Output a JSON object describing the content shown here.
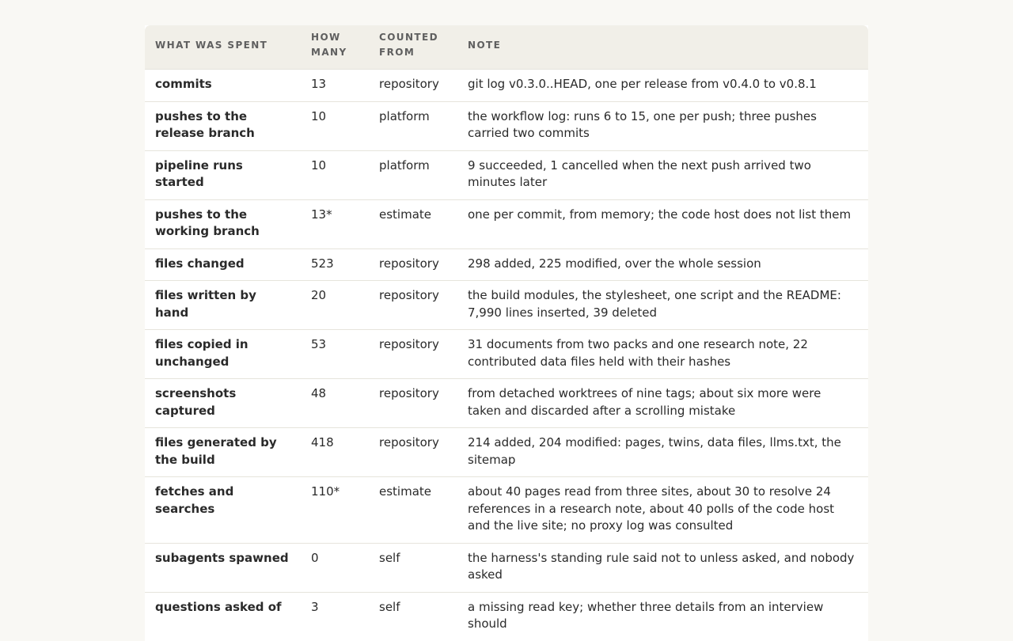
{
  "table": {
    "headers": [
      "WHAT WAS SPENT",
      "HOW MANY",
      "COUNTED FROM",
      "NOTE"
    ],
    "rows": [
      {
        "what": "commits",
        "how_many": "13",
        "counted_from": "repository",
        "note": "git log v0.3.0..HEAD, one per release from v0.4.0 to v0.8.1"
      },
      {
        "what": "pushes to the release branch",
        "how_many": "10",
        "counted_from": "platform",
        "note": "the workflow log: runs 6 to 15, one per push; three pushes carried two commits"
      },
      {
        "what": "pipeline runs started",
        "how_many": "10",
        "counted_from": "platform",
        "note": "9 succeeded, 1 cancelled when the next push arrived two minutes later"
      },
      {
        "what": "pushes to the working branch",
        "how_many": "13*",
        "counted_from": "estimate",
        "note": "one per commit, from memory; the code host does not list them"
      },
      {
        "what": "files changed",
        "how_many": "523",
        "counted_from": "repository",
        "note": "298 added, 225 modified, over the whole session"
      },
      {
        "what": "files written by hand",
        "how_many": "20",
        "counted_from": "repository",
        "note": "the build modules, the stylesheet, one script and the README: 7,990 lines inserted, 39 deleted"
      },
      {
        "what": "files copied in unchanged",
        "how_many": "53",
        "counted_from": "repository",
        "note": "31 documents from two packs and one research note, 22 contributed data files held with their hashes"
      },
      {
        "what": "screenshots captured",
        "how_many": "48",
        "counted_from": "repository",
        "note": "from detached worktrees of nine tags; about six more were taken and discarded after a scrolling mistake"
      },
      {
        "what": "files generated by the build",
        "how_many": "418",
        "counted_from": "repository",
        "note": "214 added, 204 modified: pages, twins, data files, llms.txt, the sitemap"
      },
      {
        "what": "fetches and searches",
        "how_many": "110*",
        "counted_from": "estimate",
        "note": "about 40 pages read from three sites, about 30 to resolve 24 references in a research note, about 40 polls of the code host and the live site; no proxy log was consulted"
      },
      {
        "what": "subagents spawned",
        "how_many": "0",
        "counted_from": "self",
        "note": "the harness's standing rule said not to unless asked, and nobody asked"
      },
      {
        "what": "questions asked of",
        "how_many": "3",
        "counted_from": "self",
        "note": "a missing read key; whether three details from an interview should"
      }
    ]
  }
}
